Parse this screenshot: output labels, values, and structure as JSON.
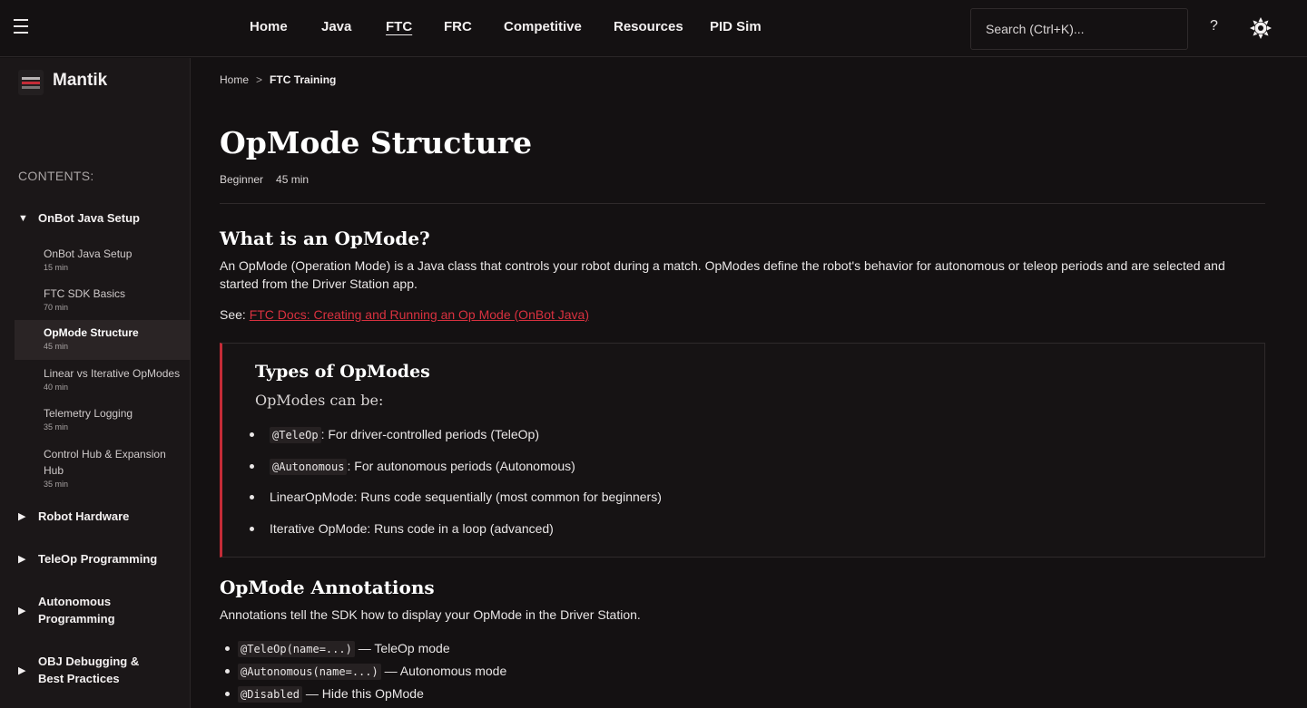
{
  "nav": {
    "items": [
      {
        "label": "Home",
        "active": false
      },
      {
        "label": "Java",
        "active": false
      },
      {
        "label": "FTC",
        "active": true
      },
      {
        "label": "FRC",
        "active": false
      },
      {
        "label": "Competitive",
        "active": false
      },
      {
        "label": "Resources",
        "active": false
      },
      {
        "label": "PID Sim",
        "active": false
      }
    ],
    "search_placeholder": "Search (Ctrl+K)...",
    "help_label": "?",
    "menu_icon": "hamburger-icon",
    "theme_icon": "sun-icon"
  },
  "sidebar": {
    "brand": "Mantik",
    "contents_label": "CONTENTS:",
    "sections": [
      {
        "label": "OnBot Java Setup",
        "expanded": true
      },
      {
        "label": "Robot Hardware",
        "expanded": false
      },
      {
        "label": "TeleOp Programming",
        "expanded": false
      },
      {
        "label": "Autonomous Programming",
        "expanded": false
      },
      {
        "label": "OBJ Debugging & Best Practices",
        "expanded": false
      }
    ],
    "lessons": [
      {
        "title": "OnBot Java Setup",
        "duration": "15 min"
      },
      {
        "title": "FTC SDK Basics",
        "duration": "70 min"
      },
      {
        "title": "OpMode Structure",
        "duration": "45 min"
      },
      {
        "title": "Linear vs Iterative OpModes",
        "duration": "40 min"
      },
      {
        "title": "Telemetry Logging",
        "duration": "35 min"
      },
      {
        "title": "Control Hub & Expansion Hub",
        "duration": "35 min"
      }
    ]
  },
  "breadcrumb": {
    "home": "Home",
    "sep": ">",
    "current": "FTC Training"
  },
  "page": {
    "title": "OpMode Structure",
    "level": "Beginner",
    "duration": "45 min"
  },
  "what_is": {
    "heading": "What is an OpMode?",
    "body": "An OpMode (Operation Mode) is a Java class that controls your robot during a match. OpModes define the robot's behavior for autonomous or teleop periods and are selected and started from the Driver Station app.",
    "see_prefix": "See: ",
    "link_text": "FTC Docs: Creating and Running an Op Mode (OnBot Java)"
  },
  "types": {
    "heading": "Types of OpModes",
    "subtitle": "OpModes can be:",
    "items": [
      {
        "code": "@TeleOp",
        "text": ": For driver-controlled periods (TeleOp)"
      },
      {
        "code": "@Autonomous",
        "text": ": For autonomous periods (Autonomous)"
      },
      {
        "code": "",
        "text": "LinearOpMode: Runs code sequentially (most common for beginners)"
      },
      {
        "code": "",
        "text": "Iterative OpMode: Runs code in a loop (advanced)"
      }
    ]
  },
  "annotations": {
    "heading": "OpMode Annotations",
    "body": "Annotations tell the SDK how to display your OpMode in the Driver Station.",
    "items": [
      {
        "code": "@TeleOp(name=...)",
        "text": " — TeleOp mode"
      },
      {
        "code": "@Autonomous(name=...)",
        "text": " — Autonomous mode"
      },
      {
        "code": "@Disabled",
        "text": " — Hide this OpMode"
      }
    ]
  },
  "colors": {
    "accent": "#c42b37",
    "link": "#d8313f",
    "background": "#141112",
    "sidebar": "#1b1718"
  }
}
